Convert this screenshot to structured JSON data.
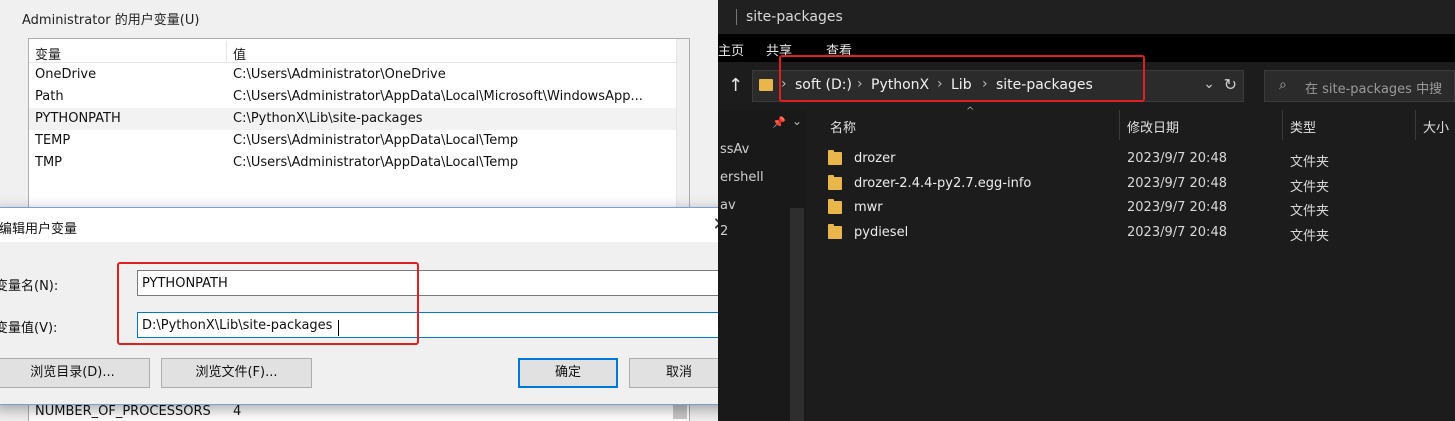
{
  "env_window": {
    "group_title": "Administrator 的用户变量(U)",
    "columns": {
      "name": "变量",
      "value": "值"
    },
    "rows": [
      {
        "name": "OneDrive",
        "value": "C:\\Users\\Administrator\\OneDrive"
      },
      {
        "name": "Path",
        "value": "C:\\Users\\Administrator\\AppData\\Local\\Microsoft\\WindowsApp..."
      },
      {
        "name": "PYTHONPATH",
        "value": "C:\\PythonX\\Lib\\site-packages"
      },
      {
        "name": "TEMP",
        "value": "C:\\Users\\Administrator\\AppData\\Local\\Temp"
      },
      {
        "name": "TMP",
        "value": "C:\\Users\\Administrator\\AppData\\Local\\Temp"
      }
    ],
    "system_row": {
      "name": "NUMBER_OF_PROCESSORS",
      "value": "4"
    }
  },
  "dialog": {
    "title": "编辑用户变量",
    "close_glyph": "✕",
    "name_label": "变量名(N):",
    "name_value": "PYTHONPATH",
    "value_label": "变量值(V):",
    "value_value": "D:\\PythonX\\Lib\\site-packages",
    "browse_dir_label": "浏览目录(D)...",
    "browse_file_label": "浏览文件(F)...",
    "ok_label": "确定",
    "cancel_label": "取消"
  },
  "explorer": {
    "title": "site-packages",
    "ribbon_tabs": [
      "主页",
      "共享",
      "查看"
    ],
    "breadcrumb": [
      "soft (D:)",
      "PythonX",
      "Lib",
      "site-packages"
    ],
    "crumb_separator": "›",
    "search_placeholder": "在 site-packages 中搜",
    "nav_fragments": [
      "ssAv",
      "ershell",
      "av",
      "2"
    ],
    "columns": {
      "name": "名称",
      "modified": "修改日期",
      "type": "类型",
      "size": "大小"
    },
    "files": [
      {
        "name": "drozer",
        "modified": "2023/9/7 20:48",
        "type": "文件夹"
      },
      {
        "name": "drozer-2.4.4-py2.7.egg-info",
        "modified": "2023/9/7 20:48",
        "type": "文件夹"
      },
      {
        "name": "mwr",
        "modified": "2023/9/7 20:48",
        "type": "文件夹"
      },
      {
        "name": "pydiesel",
        "modified": "2023/9/7 20:48",
        "type": "文件夹"
      }
    ],
    "icons": {
      "up": "↑",
      "dropdown": "⌄",
      "refresh": "↻",
      "search": "⌕",
      "pin": "📌",
      "chevron": "⌄",
      "sort": "^"
    }
  },
  "colors": {
    "highlight_box": "#e02020",
    "folder": "#e8b64a",
    "accent": "#0078d7"
  }
}
